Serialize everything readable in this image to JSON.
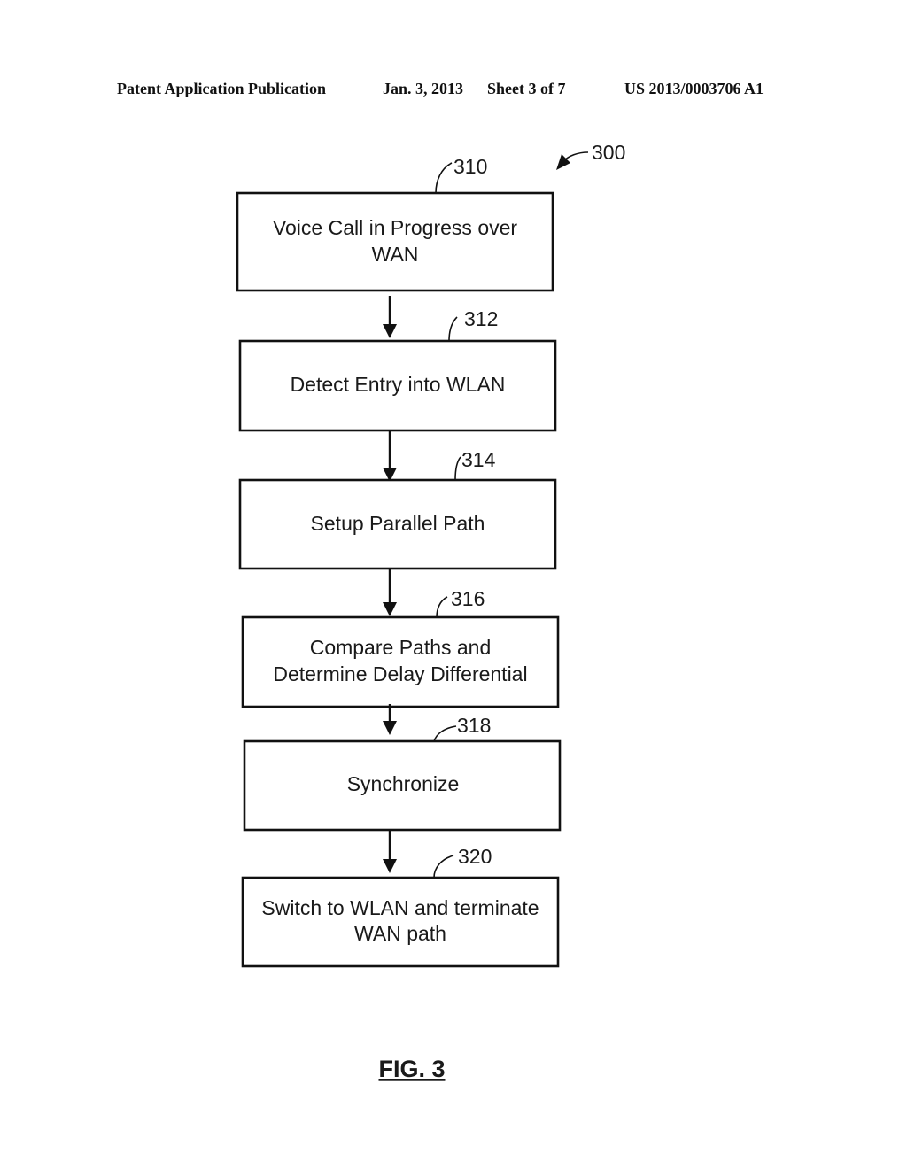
{
  "header": {
    "publication": "Patent Application Publication",
    "date": "Jan. 3, 2013",
    "sheet": "Sheet 3 of 7",
    "number": "US 2013/0003706 A1"
  },
  "figure": {
    "ref": "300",
    "label": "FIG. 3",
    "steps": [
      {
        "ref": "310",
        "lines": [
          "Voice Call in Progress over",
          "WAN"
        ]
      },
      {
        "ref": "312",
        "lines": [
          "Detect Entry into WLAN"
        ]
      },
      {
        "ref": "314",
        "lines": [
          "Setup Parallel Path"
        ]
      },
      {
        "ref": "316",
        "lines": [
          "Compare Paths and",
          "Determine Delay Differential"
        ]
      },
      {
        "ref": "318",
        "lines": [
          "Synchronize"
        ]
      },
      {
        "ref": "320",
        "lines": [
          "Switch to WLAN and terminate",
          "WAN path"
        ]
      }
    ]
  }
}
